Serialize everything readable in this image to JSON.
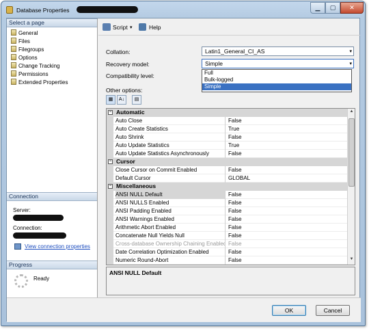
{
  "window": {
    "title": "Database Properties",
    "minimize_glyph": "▁",
    "maximize_glyph": "▢",
    "close_glyph": "✕"
  },
  "left": {
    "select_page_title": "Select a page",
    "pages": [
      {
        "label": "General",
        "icon": "page-icon"
      },
      {
        "label": "Files",
        "icon": "page-icon"
      },
      {
        "label": "Filegroups",
        "icon": "page-icon"
      },
      {
        "label": "Options",
        "icon": "page-icon"
      },
      {
        "label": "Change Tracking",
        "icon": "page-icon"
      },
      {
        "label": "Permissions",
        "icon": "page-icon"
      },
      {
        "label": "Extended Properties",
        "icon": "page-icon"
      }
    ],
    "connection_title": "Connection",
    "server_label": "Server:",
    "connection_label": "Connection:",
    "view_connection_link": "View connection properties",
    "progress_title": "Progress",
    "progress_status": "Ready"
  },
  "toolbar": {
    "script_label": "Script",
    "script_arrow": "▾",
    "help_label": "Help"
  },
  "form": {
    "collation_label": "Collation:",
    "collation_value": "Latin1_General_CI_AS",
    "recovery_label": "Recovery model:",
    "recovery_value": "Simple",
    "recovery_options": [
      "Full",
      "Bulk-logged",
      "Simple"
    ],
    "compat_label": "Compatibility level:",
    "other_options_label": "Other options:",
    "combo_arrow": "▾"
  },
  "grid": {
    "categories": [
      {
        "name": "Automatic",
        "rows": [
          {
            "name": "Auto Close",
            "value": "False"
          },
          {
            "name": "Auto Create Statistics",
            "value": "True"
          },
          {
            "name": "Auto Shrink",
            "value": "False"
          },
          {
            "name": "Auto Update Statistics",
            "value": "True"
          },
          {
            "name": "Auto Update Statistics Asynchronously",
            "value": "False"
          }
        ]
      },
      {
        "name": "Cursor",
        "rows": [
          {
            "name": "Close Cursor on Commit Enabled",
            "value": "False"
          },
          {
            "name": "Default Cursor",
            "value": "GLOBAL"
          }
        ]
      },
      {
        "name": "Miscellaneous",
        "rows": [
          {
            "name": "ANSI NULL Default",
            "value": "False",
            "selected": true
          },
          {
            "name": "ANSI NULLS Enabled",
            "value": "False"
          },
          {
            "name": "ANSI Padding Enabled",
            "value": "False"
          },
          {
            "name": "ANSI Warnings Enabled",
            "value": "False"
          },
          {
            "name": "Arithmetic Abort Enabled",
            "value": "False"
          },
          {
            "name": "Concatenate Null Yields Null",
            "value": "False"
          },
          {
            "name": "Cross-database Ownership Chaining Enabled",
            "value": "False",
            "disabled": true
          },
          {
            "name": "Date Correlation Optimization Enabled",
            "value": "False"
          },
          {
            "name": "Numeric Round-Abort",
            "value": "False"
          }
        ]
      }
    ],
    "description_title": "ANSI NULL Default"
  },
  "buttons": {
    "ok": "OK",
    "cancel": "Cancel"
  }
}
